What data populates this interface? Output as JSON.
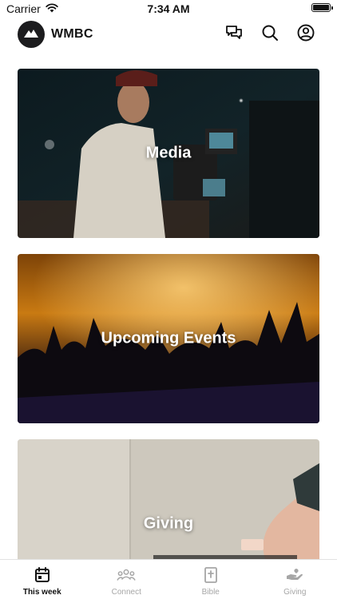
{
  "status_bar": {
    "carrier": "Carrier",
    "time": "7:34 AM",
    "icons": [
      "wifi-icon",
      "battery-icon"
    ]
  },
  "header": {
    "title": "WMBC",
    "logo_icon": "mountain-icon",
    "actions": [
      "chat-icon",
      "search-icon",
      "profile-icon"
    ]
  },
  "cards": [
    {
      "label": "Media"
    },
    {
      "label": "Upcoming Events"
    },
    {
      "label": "Giving"
    }
  ],
  "tabs": [
    {
      "label": "This week",
      "icon": "calendar-icon",
      "active": true
    },
    {
      "label": "Connect",
      "icon": "people-icon",
      "active": false
    },
    {
      "label": "Bible",
      "icon": "bible-icon",
      "active": false
    },
    {
      "label": "Giving",
      "icon": "giving-hand-icon",
      "active": false
    }
  ],
  "colors": {
    "active_tab": "#111111",
    "inactive_tab": "#a6a6a6",
    "logo_bg": "#1c1c1e"
  }
}
